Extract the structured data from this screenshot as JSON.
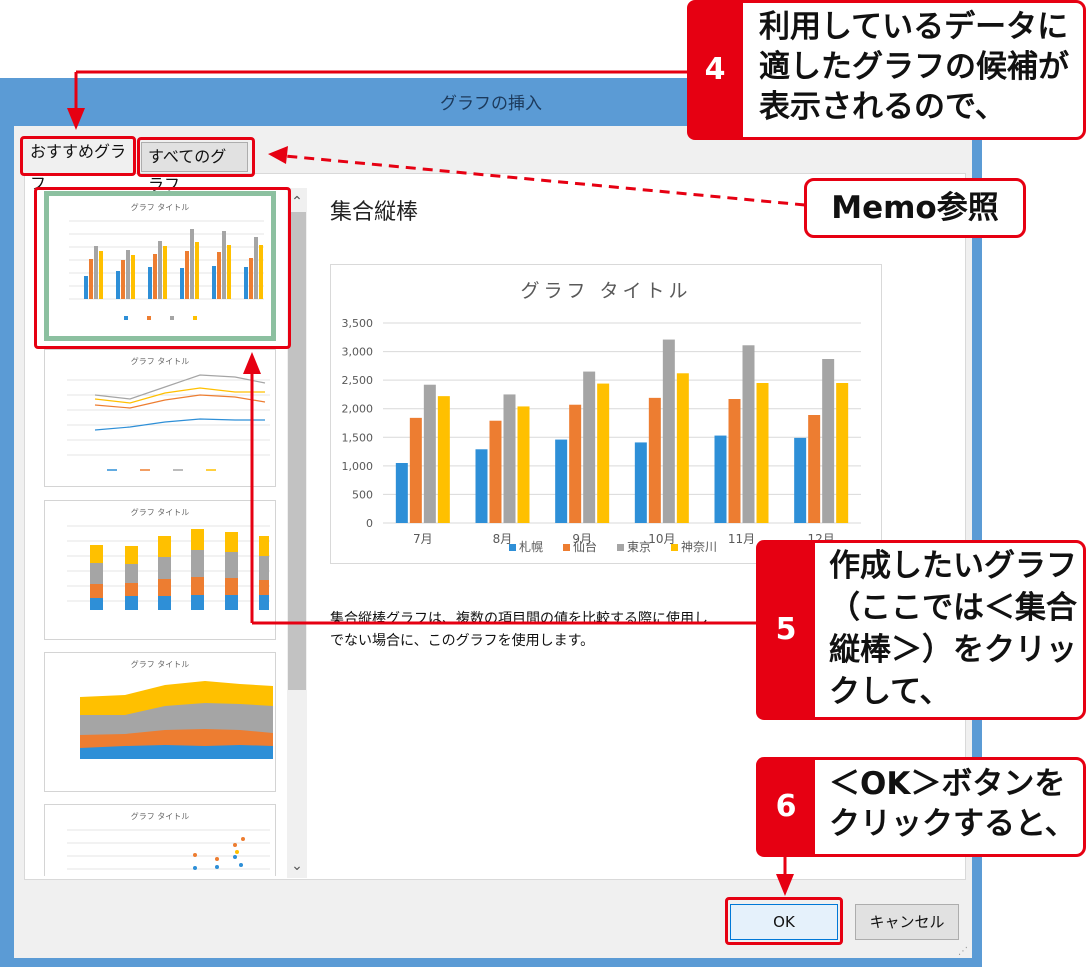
{
  "window": {
    "title": "グラフの挿入"
  },
  "tabs": {
    "recommended": "おすすめグラフ",
    "all": "すべてのグラフ"
  },
  "preview": {
    "chart_name": "集合縦棒",
    "description": "集合縦棒グラフは、複数の項目間の値を比較する際に使用し\nでない場合に、このグラフを使用します。"
  },
  "thumbnails": {
    "items": [
      {
        "title": "グラフ タイトル",
        "icon": "clustered-column-thumbnail"
      },
      {
        "title": "グラフ タイトル",
        "icon": "line-chart-thumbnail"
      },
      {
        "title": "グラフ タイトル",
        "icon": "stacked-column-thumbnail"
      },
      {
        "title": "グラフ タイトル",
        "icon": "stacked-area-thumbnail"
      },
      {
        "title": "グラフ タイトル",
        "icon": "scatter-thumbnail"
      }
    ]
  },
  "buttons": {
    "ok": "OK",
    "cancel": "キャンセル"
  },
  "annotations": {
    "step4": {
      "num": "4",
      "text": "利用しているデータに\n適したグラフの候補が\n表示されるので、"
    },
    "memo": "Memo参照",
    "step5": {
      "num": "5",
      "text": "作成したいグラフ\n（ここでは＜集合\n縦棒＞）をクリッ\nクして、"
    },
    "step6": {
      "num": "6",
      "text": "＜OK＞ボタンを\nクリックすると、"
    }
  },
  "colors": {
    "window_frame": "#5b9bd5",
    "annotation_red": "#e60012",
    "series": [
      "#2e8fd7",
      "#ed7d31",
      "#a5a5a5",
      "#ffc000"
    ]
  },
  "chart_data": {
    "type": "bar",
    "title": "グラフ タイトル",
    "categories": [
      "7月",
      "8月",
      "9月",
      "10月",
      "11月",
      "12月"
    ],
    "category_labels_visible": [
      "7月",
      "8月",
      "9月",
      "10月",
      "11月",
      "12月"
    ],
    "series": [
      {
        "name": "札幌",
        "values": [
          1050,
          1290,
          1460,
          1410,
          1530,
          1490
        ]
      },
      {
        "name": "仙台",
        "values": [
          1840,
          1790,
          2070,
          2190,
          2170,
          1890
        ]
      },
      {
        "name": "東京",
        "values": [
          2420,
          2250,
          2650,
          3210,
          3110,
          2870
        ]
      },
      {
        "name": "神奈川",
        "values": [
          2220,
          2040,
          2440,
          2620,
          2450,
          2450
        ]
      }
    ],
    "yticks": [
      "0",
      "500",
      "1,000",
      "1,500",
      "2,000",
      "2,500",
      "3,000",
      "3,500"
    ],
    "ylim": [
      0,
      3500
    ],
    "legend": "bottom",
    "grid": true
  }
}
